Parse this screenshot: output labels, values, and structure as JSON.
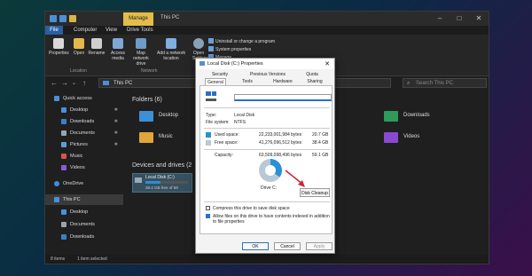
{
  "explorer": {
    "title": "This PC",
    "manage_tab": "Manage",
    "tabs": [
      "File",
      "Computer",
      "View",
      "Drive Tools"
    ],
    "ribbon": {
      "buttons": [
        "Properties",
        "Open",
        "Rename",
        "Access media",
        "Map network drive",
        "Add a network location",
        "Open Settings"
      ],
      "right_links": [
        "Uninstall or change a program",
        "System properties",
        "Manage"
      ],
      "groups": [
        "Location",
        "Network"
      ]
    },
    "address": "This PC",
    "search_placeholder": "Search This PC",
    "nav": [
      {
        "label": "Quick access",
        "icon": "star-icon",
        "pinned": false
      },
      {
        "label": "Desktop",
        "icon": "desktop-icon",
        "pinned": true
      },
      {
        "label": "Downloads",
        "icon": "download-icon",
        "pinned": true
      },
      {
        "label": "Documents",
        "icon": "documents-icon",
        "pinned": true
      },
      {
        "label": "Pictures",
        "icon": "pictures-icon",
        "pinned": true
      },
      {
        "label": "Music",
        "icon": "music-icon",
        "pinned": false
      },
      {
        "label": "Videos",
        "icon": "videos-icon",
        "pinned": false
      },
      {
        "label": "OneDrive",
        "icon": "cloud-icon",
        "pinned": false
      },
      {
        "label": "This PC",
        "icon": "pc-icon",
        "pinned": false
      },
      {
        "label": "Desktop",
        "icon": "desktop-icon",
        "pinned": false
      },
      {
        "label": "Documents",
        "icon": "documents-icon",
        "pinned": false
      },
      {
        "label": "Downloads",
        "icon": "download-icon",
        "pinned": false
      }
    ],
    "sections": {
      "folders": "Folders (6)",
      "devices": "Devices and drives (2"
    },
    "folders": [
      "Desktop",
      "Music",
      "Downloads",
      "Videos"
    ],
    "drive": {
      "name": "Local Disk (C:)",
      "free": "38.4 GB free of 59",
      "used_fraction": 0.35
    },
    "status": {
      "items": "8 items",
      "selected": "1 item selected"
    }
  },
  "dialog": {
    "title": "Local Disk (C:) Properties",
    "close": "✕",
    "tabs_top": [
      "Security",
      "Previous Versions",
      "Quota"
    ],
    "tabs_bottom": [
      "General",
      "Tools",
      "Hardware",
      "Sharing"
    ],
    "type_label": "Type:",
    "type_value": "Local Disk",
    "fs_label": "File system:",
    "fs_value": "NTFS",
    "used_label": "Used space:",
    "used_bytes": "22,233,001,984 bytes",
    "used_gb": "20.7 GB",
    "free_label": "Free space:",
    "free_bytes": "41,276,096,512 bytes",
    "free_gb": "38.4 GB",
    "cap_label": "Capacity:",
    "cap_bytes": "63,509,098,496 bytes",
    "cap_gb": "59.1 GB",
    "drive_label": "Drive C:",
    "cleanup_button": "Disk Cleanup",
    "compress_label": "Compress this drive to save disk space",
    "index_label": "Allow files on this drive to have contents indexed in addition to file properties",
    "compress_checked": false,
    "index_checked": true,
    "buttons": {
      "ok": "OK",
      "cancel": "Cancel",
      "apply": "Apply"
    },
    "colors": {
      "used": "#2a8fd4",
      "free": "#b8c8d6",
      "accent": "#2a6fc9",
      "arrow": "#d0233a"
    }
  }
}
